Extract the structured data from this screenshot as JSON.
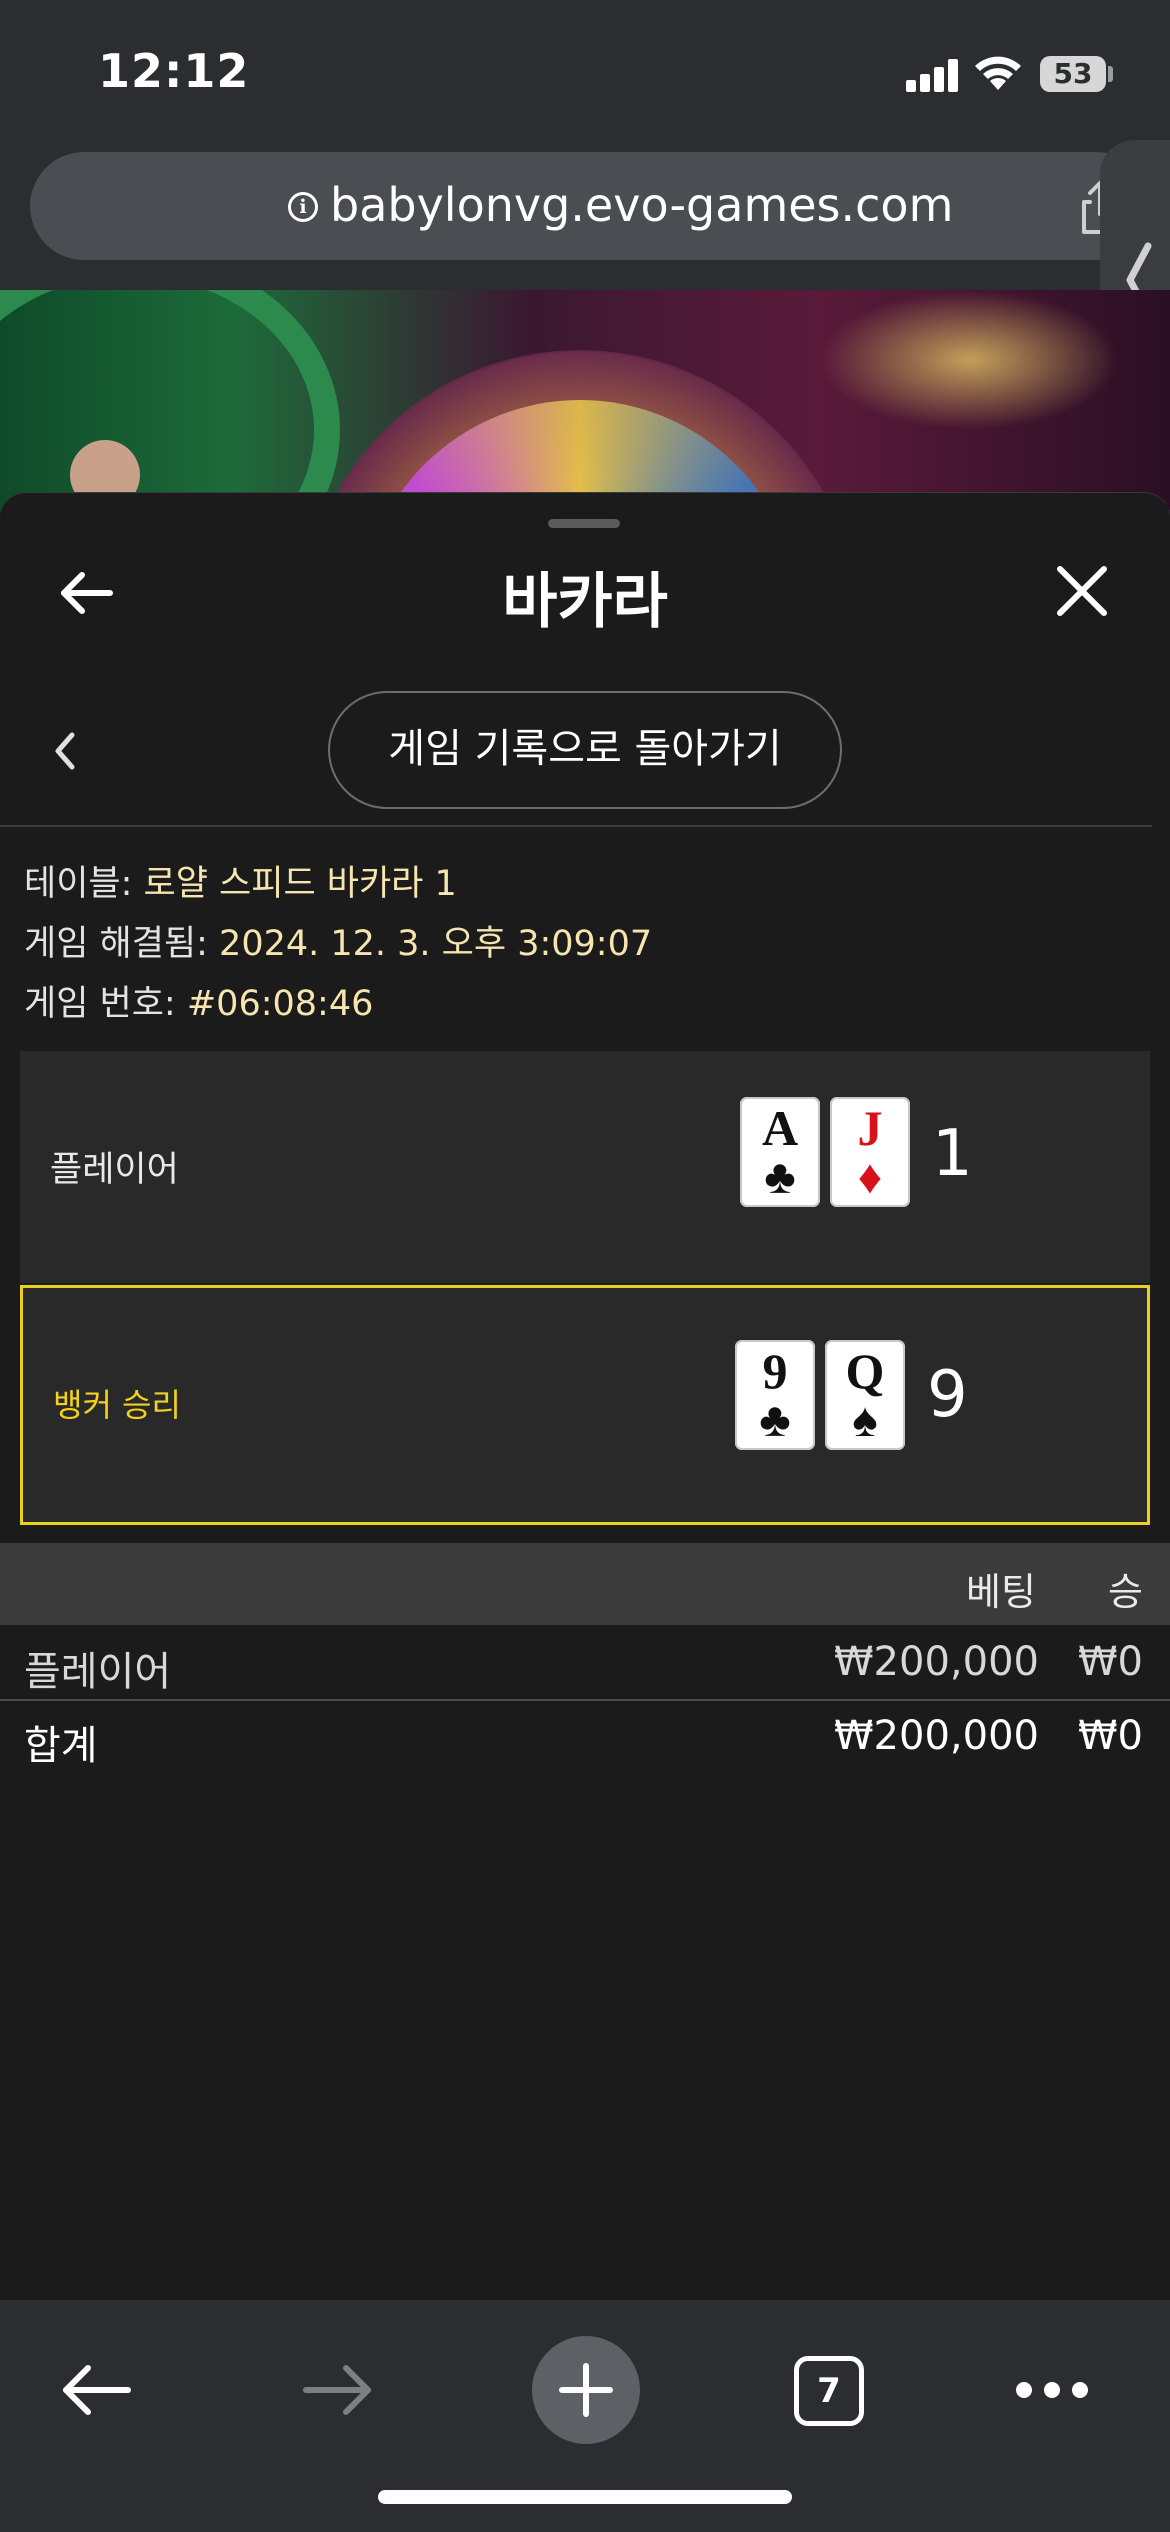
{
  "status_bar": {
    "time": "12:12",
    "battery": "53"
  },
  "browser": {
    "url": "babylonvg.evo-games.com",
    "tab_count": "7"
  },
  "sheet": {
    "title": "바카라",
    "history_button": "게임 기록으로 돌아가기"
  },
  "info": {
    "table_label": "테이블: ",
    "table_value": "로얄 스피드 바카라 1",
    "resolved_label": "게임 해결됨: ",
    "resolved_value": "2024. 12. 3. 오후 3:09:07",
    "game_no_label": "게임 번호: ",
    "game_no_value": "#06:08:46"
  },
  "results": {
    "player": {
      "label": "플레이어",
      "cards": [
        {
          "rank": "A",
          "suit": "♣",
          "color": "black"
        },
        {
          "rank": "J",
          "suit": "♦",
          "color": "red"
        }
      ],
      "score": "1"
    },
    "banker": {
      "label": "뱅커 승리",
      "cards": [
        {
          "rank": "9",
          "suit": "♣",
          "color": "black"
        },
        {
          "rank": "Q",
          "suit": "♠",
          "color": "black"
        }
      ],
      "score": "9"
    }
  },
  "bets": {
    "headers": {
      "bet": "베팅",
      "win": "승"
    },
    "rows": [
      {
        "name": "플레이어",
        "bet": "₩200,000",
        "win": "₩0"
      }
    ],
    "total": {
      "name": "합계",
      "bet": "₩200,000",
      "win": "₩0"
    }
  },
  "colors": {
    "winner_accent": "#e9d11e",
    "info_value": "#f7e5b0",
    "sheet_bg": "#1b1b1b"
  }
}
